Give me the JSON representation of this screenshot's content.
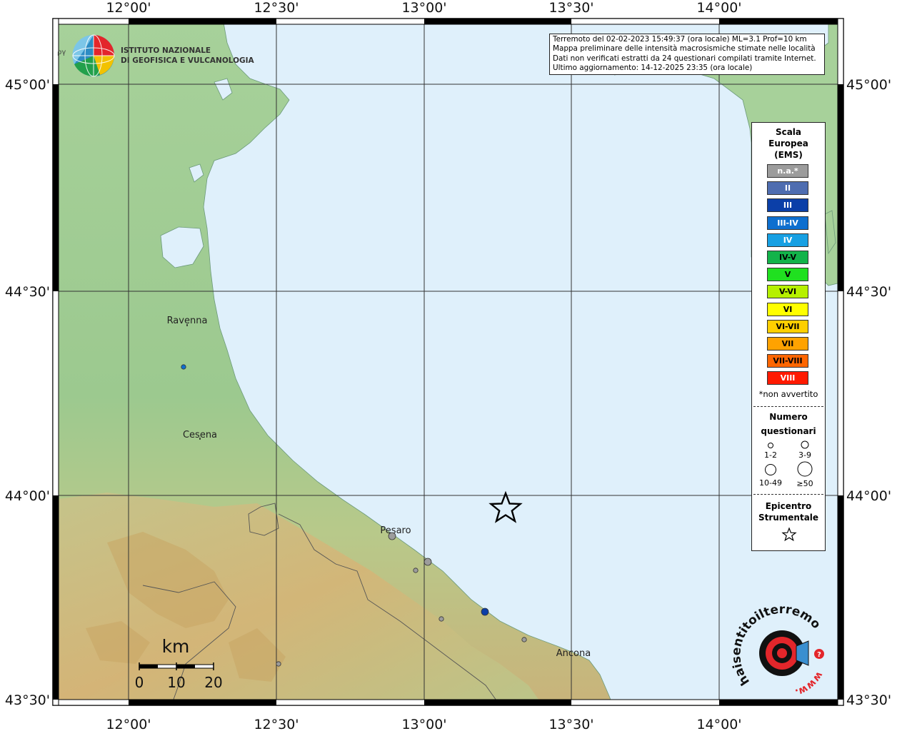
{
  "info": {
    "line1": "Terremoto del 02-02-2023 15:49:37 (ora locale) ML=3.1 Prof=10 km",
    "line2": "Mappa preliminare delle intensità macrosismiche stimate nelle località",
    "line3": "Dati non verificati estratti da 24 questionari compilati tramite Internet.",
    "line4": "Ultimo aggiornamento: 14-12-2025 23:35 (ora locale)"
  },
  "logo": {
    "line1": "ISTITUTO NAZIONALE",
    "line2": "DI GEOFISICA E VULCANOLOGIA",
    "fragment": "ργ"
  },
  "axes": {
    "lon_labels": [
      "12°00'",
      "12°30'",
      "13°00'",
      "13°30'",
      "14°00'"
    ],
    "lat_labels": [
      "45°00'",
      "44°30'",
      "44°00'",
      "43°30'"
    ]
  },
  "cities": [
    {
      "name": "Ravenna"
    },
    {
      "name": "Cesena"
    },
    {
      "name": "Pesaro"
    },
    {
      "name": "Ancona"
    }
  ],
  "scale_bar": {
    "unit": "km",
    "ticks": [
      "0",
      "10",
      "20"
    ]
  },
  "legend": {
    "title_lines": [
      "Scala",
      "Europea",
      "(EMS)"
    ],
    "classes": [
      {
        "label": "n.a.*",
        "color": "#9c9c9c",
        "text_color": "#ffffff"
      },
      {
        "label": "II",
        "color": "#4f6db0",
        "text_color": "#ffffff"
      },
      {
        "label": "III",
        "color": "#0b3fa8",
        "text_color": "#ffffff"
      },
      {
        "label": "III-IV",
        "color": "#0e6fcf",
        "text_color": "#ffffff"
      },
      {
        "label": "IV",
        "color": "#17a0e3",
        "text_color": "#ffffff"
      },
      {
        "label": "IV-V",
        "color": "#13b34a",
        "text_color": "#000000"
      },
      {
        "label": "V",
        "color": "#20e020",
        "text_color": "#000000"
      },
      {
        "label": "V-VI",
        "color": "#b6f000",
        "text_color": "#000000"
      },
      {
        "label": "VI",
        "color": "#ffff00",
        "text_color": "#000000"
      },
      {
        "label": "VI-VII",
        "color": "#ffcf00",
        "text_color": "#000000"
      },
      {
        "label": "VII",
        "color": "#ffa200",
        "text_color": "#000000"
      },
      {
        "label": "VII-VIII",
        "color": "#ff6600",
        "text_color": "#000000"
      },
      {
        "label": "VIII",
        "color": "#ff1a00",
        "text_color": "#ffffff"
      }
    ],
    "not_felt_note": "*non avvertito",
    "count_title_lines": [
      "Numero",
      "questionari"
    ],
    "count_classes": [
      "1-2",
      "3-9",
      "10-49",
      "≥50"
    ],
    "epicenter_title_lines": [
      "Epicentro",
      "Strumentale"
    ]
  },
  "observations": [
    {
      "intensity": "III",
      "count": "1-2"
    },
    {
      "intensity": "n.a.*",
      "count": "3-9"
    },
    {
      "intensity": "n.a.*",
      "count": "1-2"
    },
    {
      "intensity": "n.a.*",
      "count": "3-9"
    },
    {
      "intensity": "n.a.*",
      "count": "1-2"
    },
    {
      "intensity": "III",
      "count": "3-9"
    },
    {
      "intensity": "n.a.*",
      "count": "1-2"
    },
    {
      "intensity": "n.a.*",
      "count": "1-2"
    }
  ],
  "watermark": {
    "text1": "haisentitoilterremoto.it",
    "text2": "www."
  },
  "colors": {
    "sea": "#dff0fb",
    "land": "#9cc98f",
    "epicenter_stroke": "#000000"
  }
}
